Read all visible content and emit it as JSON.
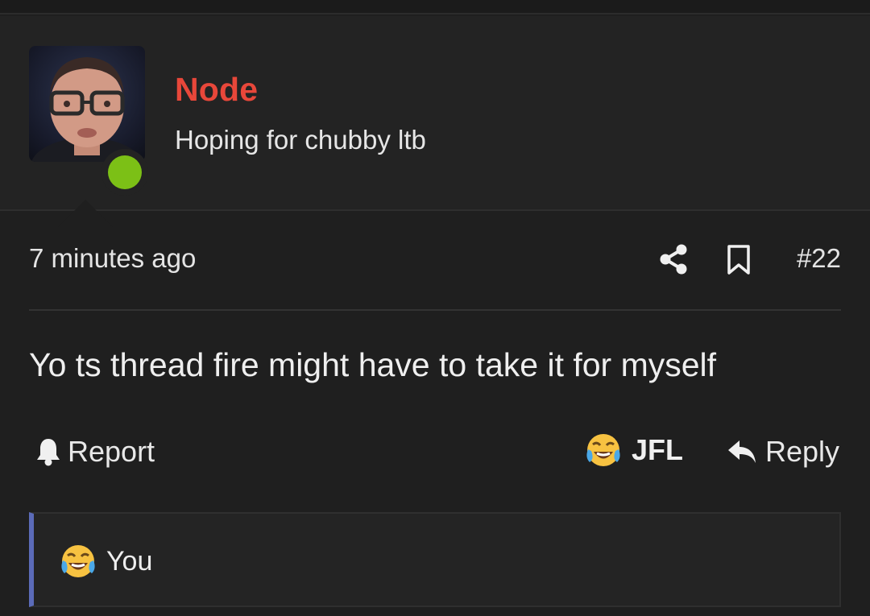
{
  "user": {
    "name": "Node",
    "title": "Hoping for chubby ltb",
    "status": "online",
    "name_color": "#e8473a",
    "online_color": "#7cc016"
  },
  "post": {
    "timestamp": "7 minutes ago",
    "number": "#22",
    "body": "Yo ts thread fire might have to take it for myself"
  },
  "actions": {
    "report_label": "Report",
    "reaction_label": "JFL",
    "reply_label": "Reply"
  },
  "reactions": {
    "summary_label": "You",
    "accent_color": "#5b6bb8"
  },
  "icons": {
    "share": "share-icon",
    "bookmark": "bookmark-icon",
    "report": "bell-icon",
    "reply": "reply-arrow-icon",
    "reaction": "laughing-crying-emoji-icon"
  }
}
